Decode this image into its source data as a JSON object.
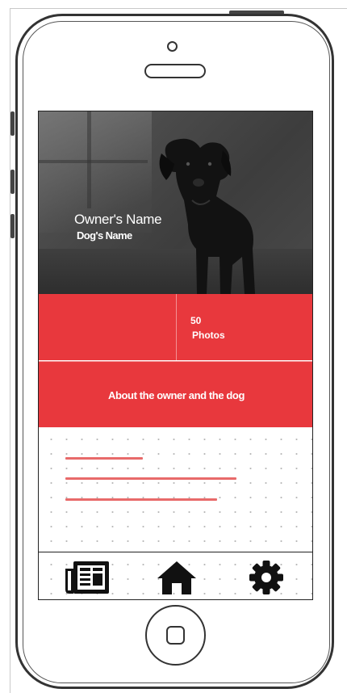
{
  "profile": {
    "owner_name": "Owner's Name",
    "dog_name": "Dog's Name"
  },
  "stats": {
    "photos_count": "50",
    "photos_label": "Photos"
  },
  "about": {
    "title": "About the owner and the dog"
  },
  "tabbar": {
    "items": [
      {
        "icon": "newspaper-icon"
      },
      {
        "icon": "home-icon"
      },
      {
        "icon": "gear-icon"
      }
    ]
  },
  "colors": {
    "accent_red": "#e8383d",
    "line_red": "#e86a6a",
    "outline": "#333333"
  }
}
